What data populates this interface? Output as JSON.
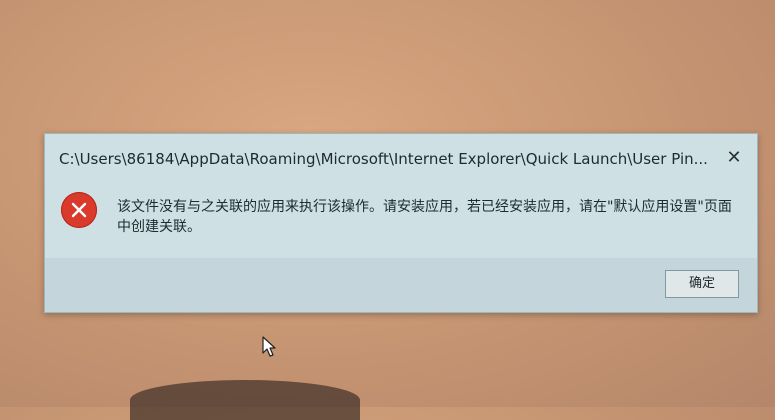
{
  "dialog": {
    "title": "C:\\Users\\86184\\AppData\\Roaming\\Microsoft\\Internet Explorer\\Quick Launch\\User Pin...",
    "close_glyph": "✕",
    "icon": "error-icon",
    "message": "该文件没有与之关联的应用来执行该操作。请安装应用，若已经安装应用，请在\"默认应用设置\"页面中创建关联。",
    "ok_label": "确定"
  },
  "colors": {
    "error": "#d93a2b",
    "dialog_bg": "#cfe0e4"
  }
}
